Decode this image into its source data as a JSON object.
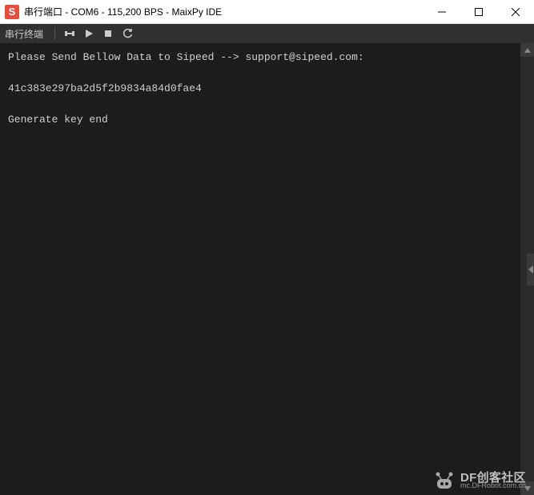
{
  "window": {
    "title": "串行端口 - COM6 - 115,200 BPS - MaixPy IDE"
  },
  "toolbar": {
    "label": "串行终端"
  },
  "terminal": {
    "line1": "Please Send Bellow Data to Sipeed --> support@sipeed.com:",
    "line2": "41c383e297ba2d5f2b9834a84d0fae4",
    "line3": "Generate key end"
  },
  "watermark": {
    "main": "DF创客社区",
    "sub": "mc.DFRobot.com.cn"
  }
}
